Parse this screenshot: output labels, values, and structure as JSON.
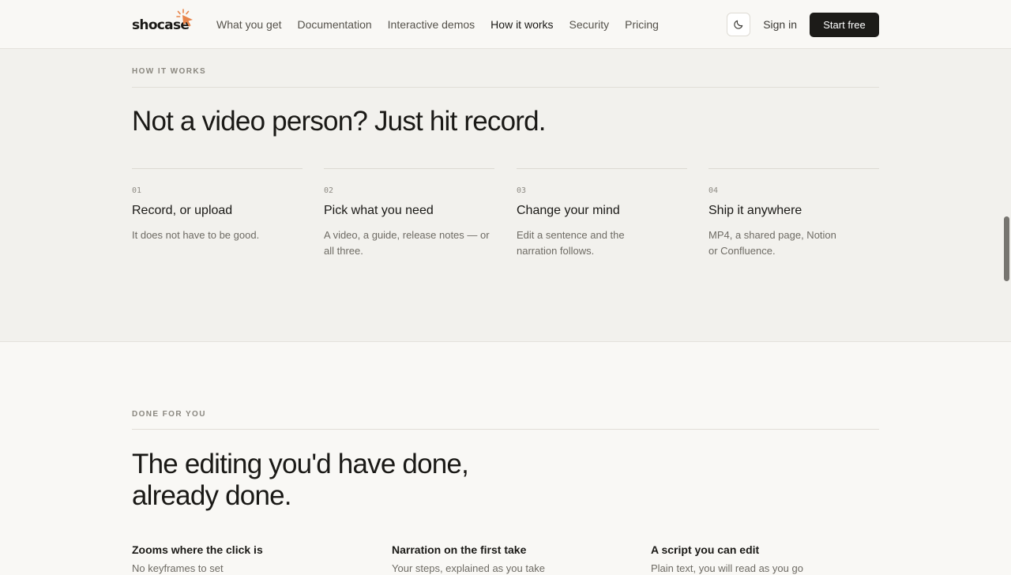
{
  "nav": {
    "logo_text": "shocase",
    "links": [
      {
        "label": "What you get"
      },
      {
        "label": "Documentation"
      },
      {
        "label": "Interactive demos"
      },
      {
        "label": "How it works"
      },
      {
        "label": "Security"
      },
      {
        "label": "Pricing"
      }
    ],
    "active_link": "How it works",
    "theme_toggle_icon": "moon-icon",
    "signin_label": "Sign in",
    "cta_label": "Start free"
  },
  "how_it_works": {
    "eyebrow": "HOW IT WORKS",
    "heading": "Not a video person? Just hit record.",
    "steps": [
      {
        "num": "01",
        "title": "Record, or upload",
        "desc": "It does not have to be good."
      },
      {
        "num": "02",
        "title": "Pick what you need",
        "desc": "A video, a guide, release notes — or all three."
      },
      {
        "num": "03",
        "title": "Change your mind",
        "desc": "Edit a sentence and the narration follows."
      },
      {
        "num": "04",
        "title": "Ship it anywhere",
        "desc": "MP4, a shared page, Notion or Confluence."
      }
    ]
  },
  "done_for_you": {
    "eyebrow": "DONE FOR YOU",
    "heading_line1": "The editing you'd have done,",
    "heading_line2": "already done.",
    "features": [
      {
        "title": "Zooms where the click is",
        "desc": "No keyframes to set"
      },
      {
        "title": "Narration on the first take",
        "desc": "Your steps, explained as you take"
      },
      {
        "title": "A script you can edit",
        "desc": "Plain text, you will read as you go"
      }
    ]
  },
  "colors": {
    "accent": "#e8844a",
    "primary_button": "#1c1b18",
    "section_bg": "#f2f1ed",
    "page_bg": "#f9f8f5"
  }
}
